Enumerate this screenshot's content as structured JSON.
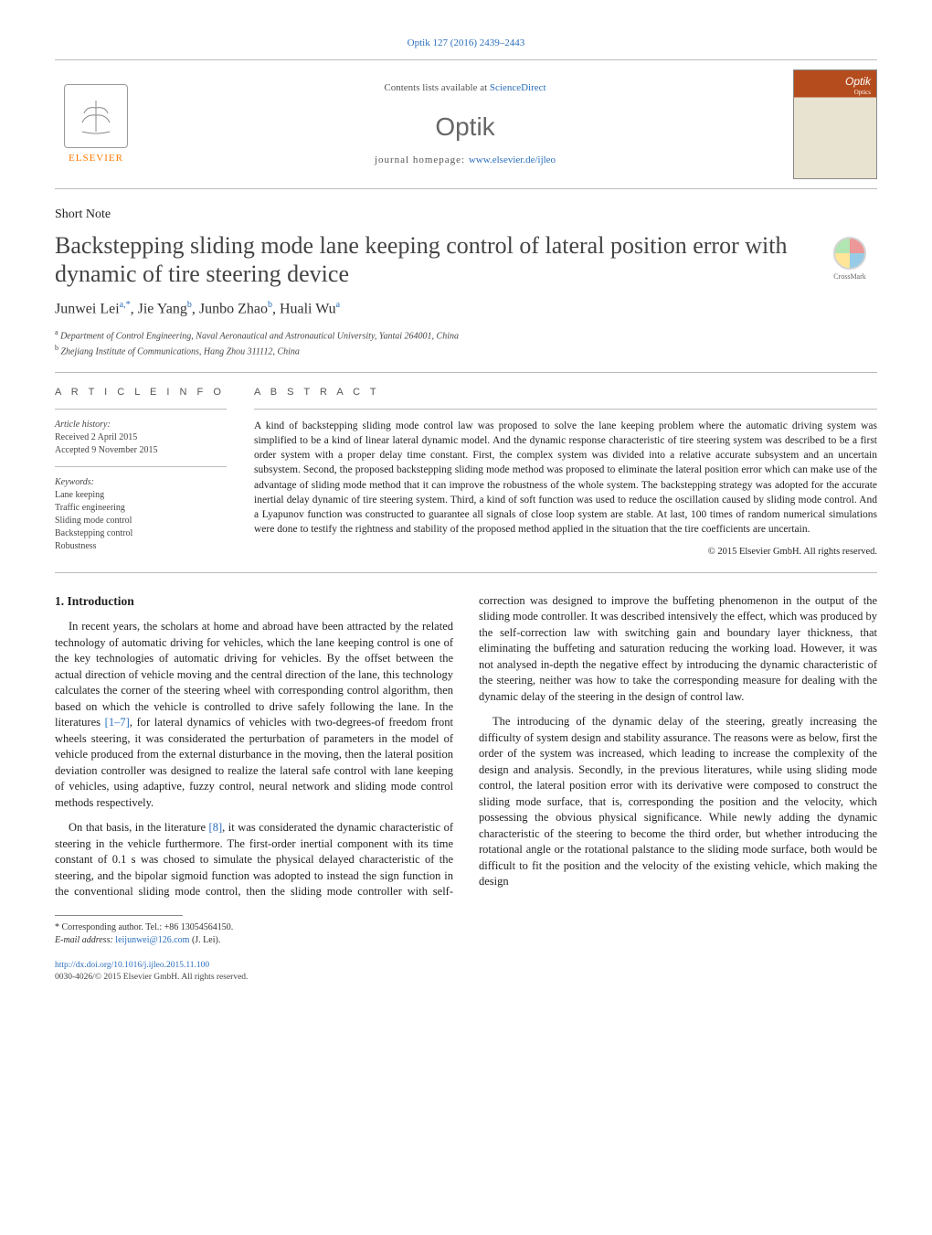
{
  "citation": "Optik 127 (2016) 2439–2443",
  "banner": {
    "contents_label": "Contents lists available at",
    "contents_link": "ScienceDirect",
    "journal": "Optik",
    "homepage_label": "journal homepage:",
    "homepage_url": "www.elsevier.de/ijleo",
    "elsevier": "ELSEVIER",
    "cover_title": "Optik",
    "cover_sub": "Optics"
  },
  "article_type": "Short Note",
  "title": "Backstepping sliding mode lane keeping control of lateral position error with dynamic of tire steering device",
  "crossmark": "CrossMark",
  "authors_html": {
    "a1_name": "Junwei Lei",
    "a1_sup": "a,*",
    "a2_name": "Jie Yang",
    "a2_sup": "b",
    "a3_name": "Junbo Zhao",
    "a3_sup": "b",
    "a4_name": "Huali Wu",
    "a4_sup": "a"
  },
  "affiliations": {
    "a": "Department of Control Engineering, Naval Aeronautical and Astronautical University, Yantai 264001, China",
    "b": "Zhejiang Institute of Communications, Hang Zhou 311112, China"
  },
  "article_info": {
    "heading": "A R T I C L E   I N F O",
    "history_label": "Article history:",
    "received": "Received 2 April 2015",
    "accepted": "Accepted 9 November 2015",
    "keywords_label": "Keywords:",
    "keywords": [
      "Lane keeping",
      "Traffic engineering",
      "Sliding mode control",
      "Backstepping control",
      "Robustness"
    ]
  },
  "abstract": {
    "heading": "A B S T R A C T",
    "text": "A kind of backstepping sliding mode control law was proposed to solve the lane keeping problem where the automatic driving system was simplified to be a kind of linear lateral dynamic model. And the dynamic response characteristic of tire steering system was described to be a first order system with a proper delay time constant. First, the complex system was divided into a relative accurate subsystem and an uncertain subsystem. Second, the proposed backstepping sliding mode method was proposed to eliminate the lateral position error which can make use of the advantage of sliding mode method that it can improve the robustness of the whole system. The backstepping strategy was adopted for the accurate inertial delay dynamic of tire steering system. Third, a kind of soft function was used to reduce the oscillation caused by sliding mode control. And a Lyapunov function was constructed to guarantee all signals of close loop system are stable. At last, 100 times of random numerical simulations were done to testify the rightness and stability of the proposed method applied in the situation that the tire coefficients are uncertain.",
    "copyright": "© 2015 Elsevier GmbH. All rights reserved."
  },
  "sections": {
    "intro_heading": "1. Introduction",
    "p1": "In recent years, the scholars at home and abroad have been attracted by the related technology of automatic driving for vehicles, which the lane keeping control is one of the key technologies of automatic driving for vehicles. By the offset between the actual direction of vehicle moving and the central direction of the lane, this technology calculates the corner of the steering wheel with corresponding control algorithm, then based on which the vehicle is controlled to drive safely following the lane. In the literatures ",
    "p1_ref": "[1–7]",
    "p1b": ", for lateral dynamics of vehicles with two-degrees-of freedom front wheels steering, it was considerated the perturbation of parameters in the model of vehicle produced from the external disturbance in the moving, then the lateral position deviation controller was designed to realize the lateral safe control with lane keeping of vehicles, using adaptive, fuzzy control, neural network and sliding mode control methods respectively.",
    "p2a": "On that basis, in the literature ",
    "p2_ref": "[8]",
    "p2b": ", it was considerated the dynamic characteristic of steering in the vehicle furthermore. The first-order inertial component with its time constant of 0.1 s was chosed to simulate the physical delayed characteristic of the steering, and the bipolar sigmoid function was adopted to instead the sign function in the conventional sliding mode control, then the sliding mode controller with self-correction was designed to improve the buffeting phenomenon in the output of the sliding mode controller. It was described intensively the effect, which was produced by the self-correction law with switching gain and boundary layer thickness, that eliminating the buffeting and saturation reducing the working load. However, it was not analysed in-depth the negative effect by introducing the dynamic characteristic of the steering, neither was how to take the corresponding measure for dealing with the dynamic delay of the steering in the design of control law.",
    "p3": "The introducing of the dynamic delay of the steering, greatly increasing the difficulty of system design and stability assurance. The reasons were as below, first the order of the system was increased, which leading to increase the complexity of the design and analysis. Secondly, in the previous literatures, while using sliding mode control, the lateral position error with its derivative were composed to construct the sliding mode surface, that is, corresponding the position and the velocity, which possessing the obvious physical significance. While newly adding the dynamic characteristic of the steering to become the third order, but whether introducing the rotational angle or the rotational palstance to the sliding mode surface, both would be difficult to fit the position and the velocity of the existing vehicle, which making the design"
  },
  "footnote": {
    "corr_label": "* Corresponding author. Tel.: +86 13054564150.",
    "email_label": "E-mail address:",
    "email": "leijunwei@126.com",
    "email_who": "(J. Lei)."
  },
  "doi_block": {
    "doi": "http://dx.doi.org/10.1016/j.ijleo.2015.11.100",
    "line2": "0030-4026/© 2015 Elsevier GmbH. All rights reserved."
  }
}
